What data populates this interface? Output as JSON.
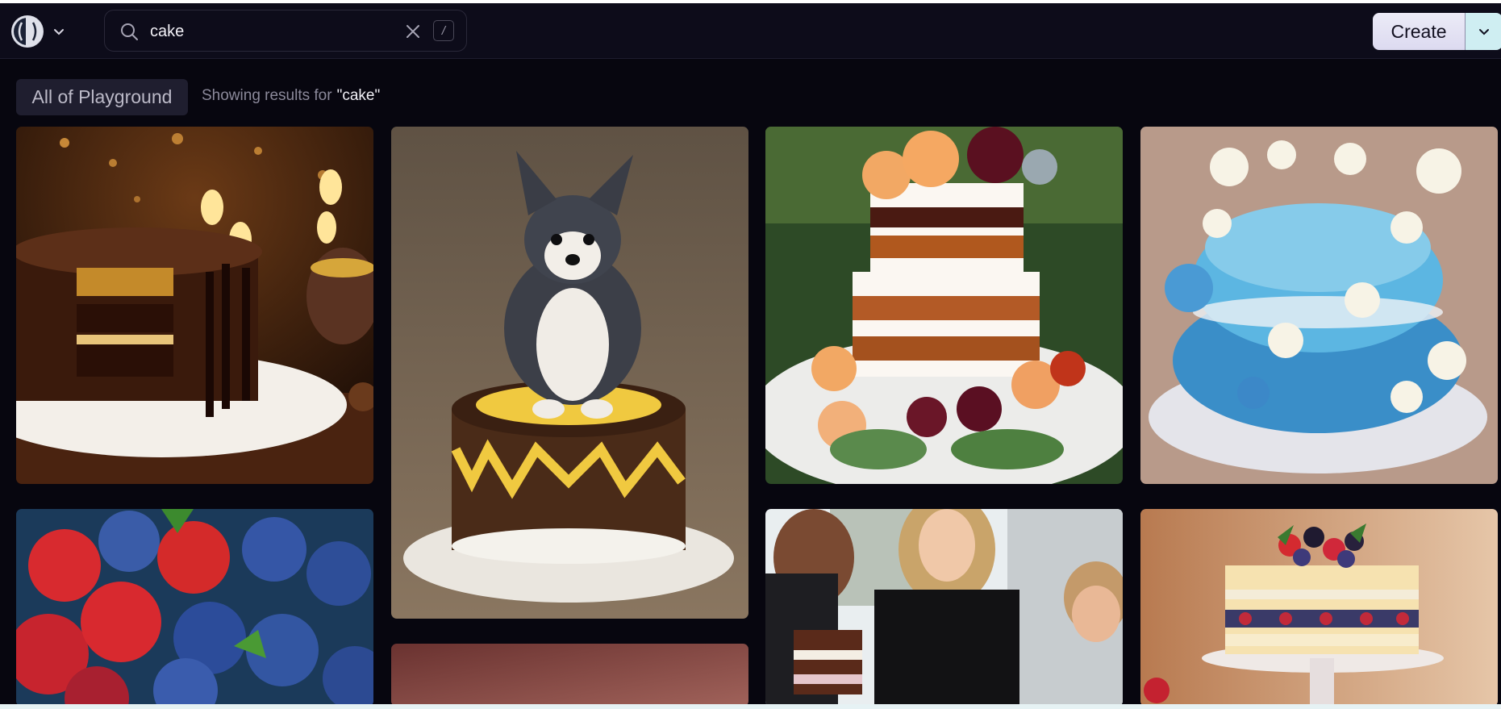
{
  "header": {
    "search": {
      "value": "cake",
      "shortcut_hint": "/"
    },
    "create_label": "Create"
  },
  "filter": {
    "scope_label": "All of Playground",
    "results_prefix": "Showing results for",
    "results_query": "\"cake\""
  },
  "icons": [
    "playground-logo-icon",
    "chevron-down-icon",
    "search-icon",
    "clear-icon",
    "slash-key-icon"
  ],
  "colors": {
    "background": "#07060f",
    "header": "#0d0c1a",
    "accent_create": "#e6e4f5"
  },
  "gallery": [
    {
      "name": "chocolate-cake"
    },
    {
      "name": "puppy-on-cake"
    },
    {
      "name": "naked-layer-cake-with-flowers"
    },
    {
      "name": "blue-floral-cake"
    },
    {
      "name": "berries-closeup"
    },
    {
      "name": "pink-blank-tile"
    },
    {
      "name": "people-with-cake"
    },
    {
      "name": "berry-layer-cake"
    }
  ]
}
